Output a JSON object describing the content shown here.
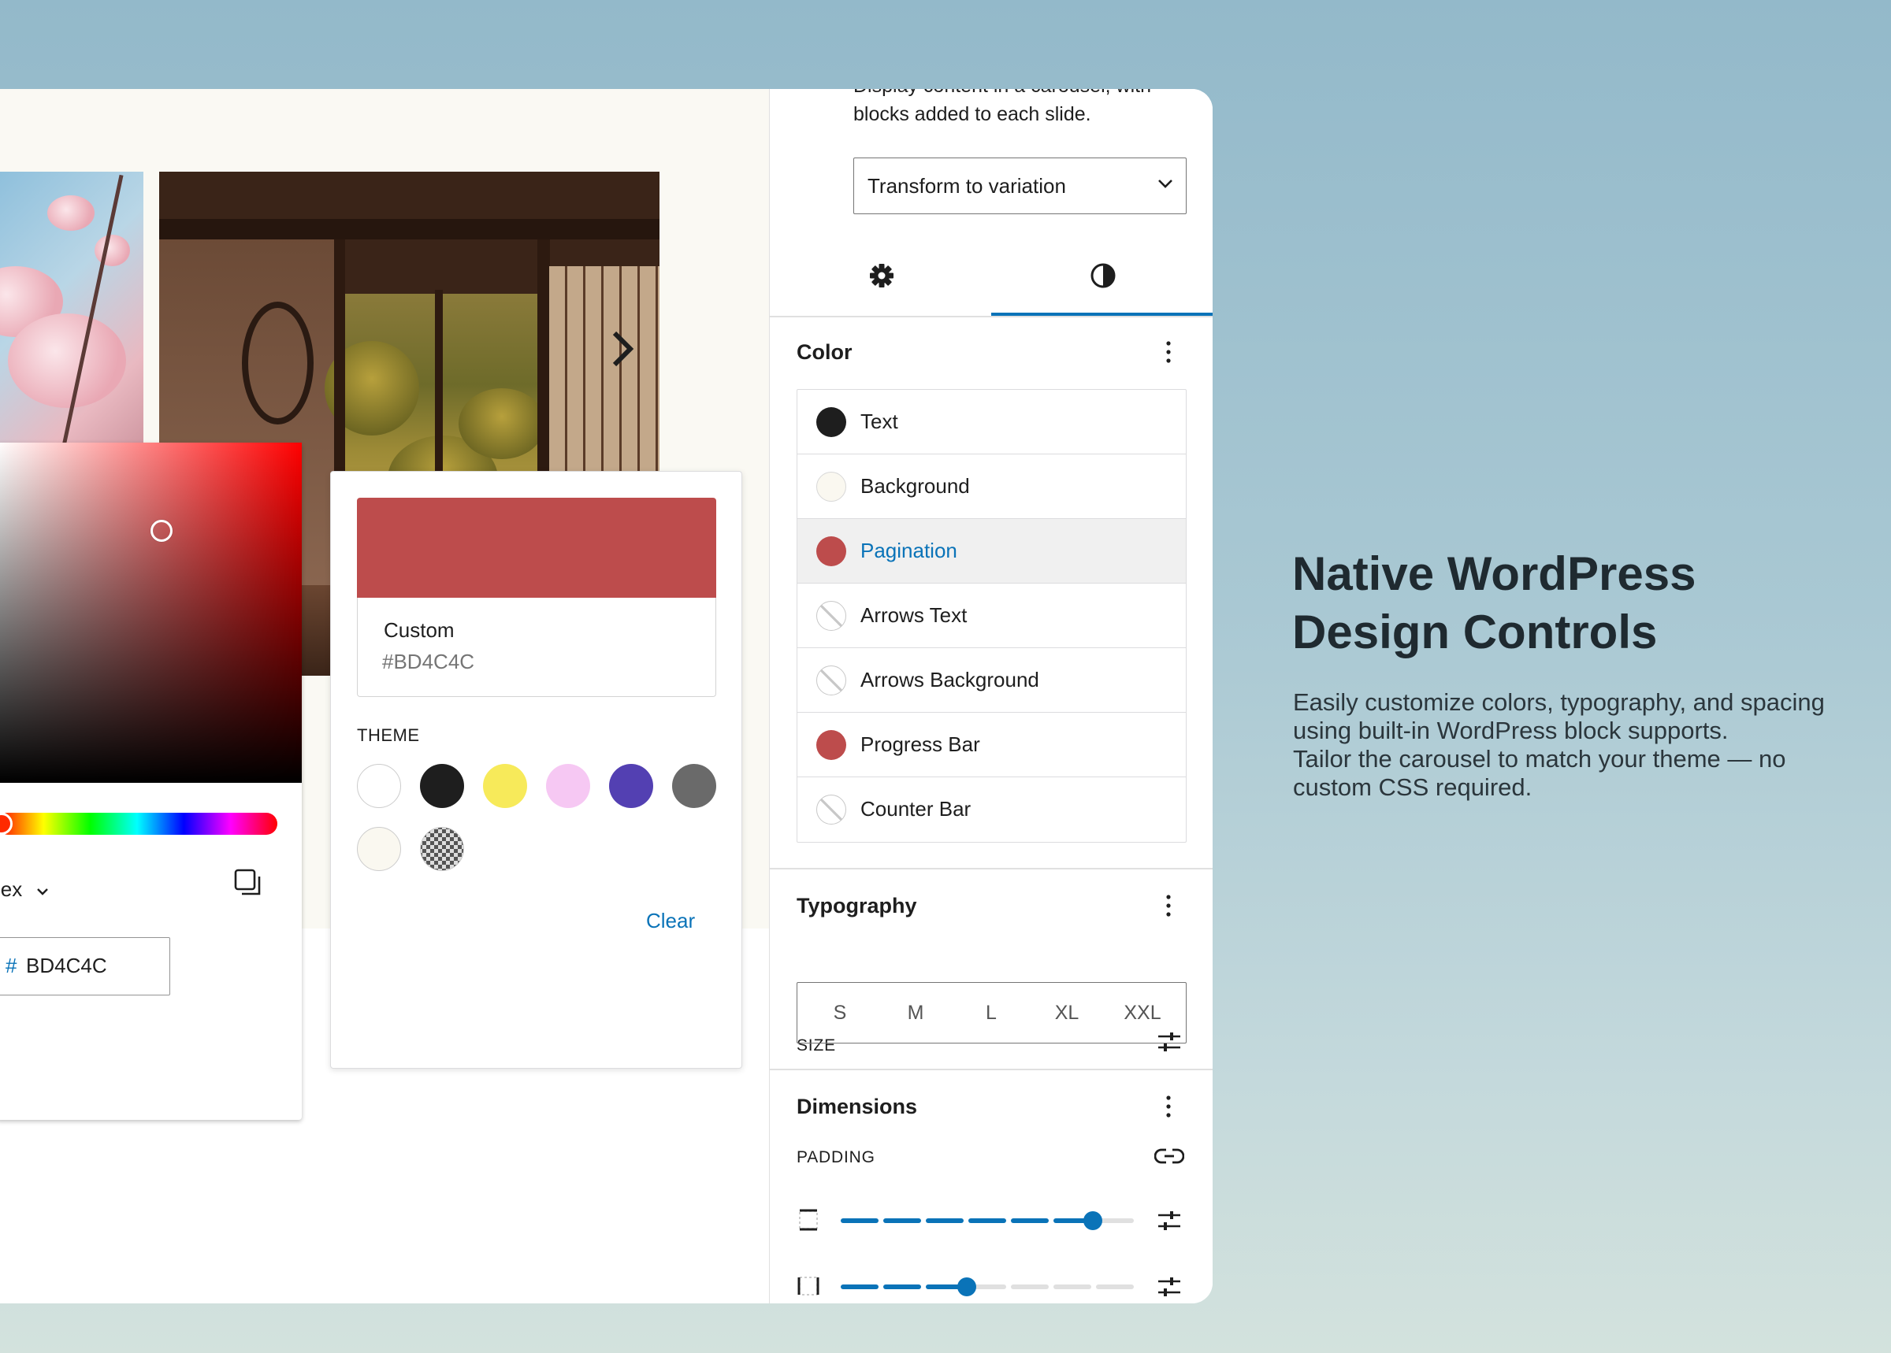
{
  "canvas": {
    "next_arrow": "chevron-right-icon"
  },
  "picker": {
    "format_label": "Hex",
    "hex_hash": "#",
    "hex_value": "BD4C4C"
  },
  "popover": {
    "custom_name": "Custom",
    "custom_hex": "#BD4C4C",
    "custom_color": "#bd4c4c",
    "theme_label": "THEME",
    "theme_colors": [
      "#ffffff",
      "#1e1e1e",
      "#f7ea5a",
      "#f6c8f3",
      "#5340b2",
      "#6a6a6a",
      "#faf8f0",
      "transparent"
    ],
    "clear_label": "Clear"
  },
  "sidebar": {
    "description": "Display content in a carousel, with blocks added to each slide.",
    "transform_label": "Transform to variation",
    "tabs": [
      {
        "icon": "gear-icon"
      },
      {
        "icon": "contrast-icon",
        "active": true
      }
    ],
    "color": {
      "title": "Color",
      "items": [
        {
          "label": "Text",
          "color": "#1e1e1e"
        },
        {
          "label": "Background",
          "color": "#faf8f0"
        },
        {
          "label": "Pagination",
          "color": "#bd4c4c",
          "active": true
        },
        {
          "label": "Arrows Text",
          "color": "none"
        },
        {
          "label": "Arrows Background",
          "color": "none"
        },
        {
          "label": "Progress Bar",
          "color": "#bd4c4c"
        },
        {
          "label": "Counter Bar",
          "color": "none"
        }
      ]
    },
    "typography": {
      "title": "Typography",
      "size_label": "SIZE",
      "sizes": [
        "S",
        "M",
        "L",
        "XL",
        "XXL"
      ]
    },
    "dimensions": {
      "title": "Dimensions",
      "padding_label": "PADDING",
      "padding_vertical_level": 0.86,
      "padding_horizontal_level": 0.43
    }
  },
  "hero": {
    "title": "Native WordPress Design Controls",
    "body_1": "Easily customize colors, typography, and spacing using built-in WordPress block supports.",
    "body_2": "Tailor the carousel to match your theme — no custom CSS required."
  },
  "colors": {
    "accent": "#0a73b8",
    "pagination": "#bd4c4c"
  }
}
